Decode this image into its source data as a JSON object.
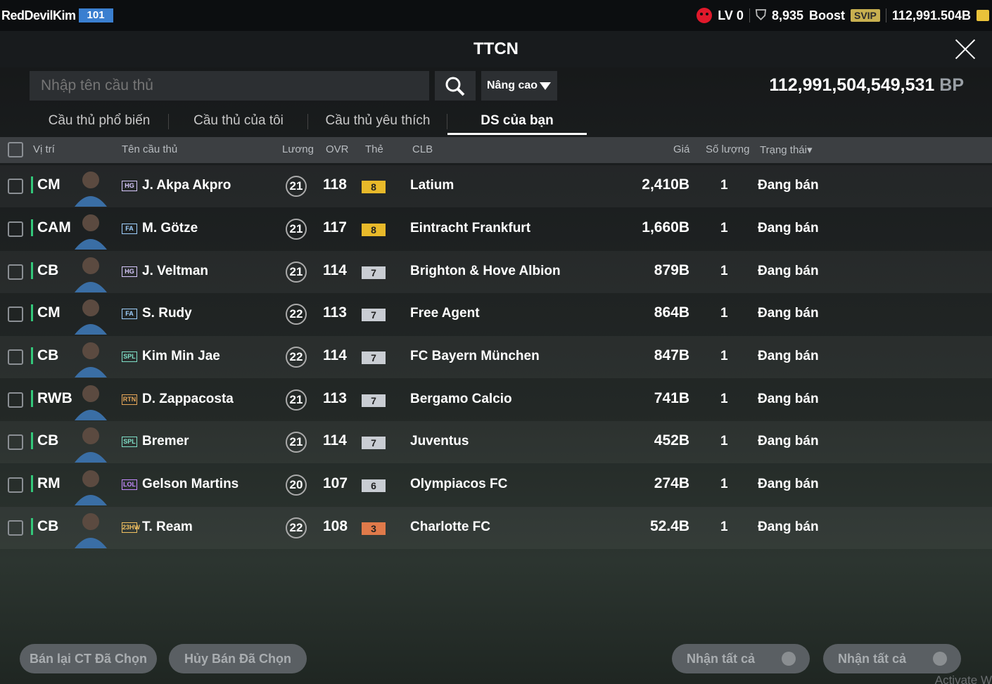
{
  "topbar": {
    "username": "RedDevilKim",
    "level_badge": "101",
    "lv": "LV 0",
    "shield_count": "8,935",
    "boost": "Boost",
    "svip": "SVIP",
    "coins": "112,991.504B"
  },
  "title": "TTCN",
  "search": {
    "placeholder": "Nhập tên cầu thủ",
    "advanced": "Nâng cao"
  },
  "bp": {
    "value": "112,991,504,549,531",
    "unit": "BP"
  },
  "tabs": [
    "Cầu thủ phổ biến",
    "Cầu thủ của tôi",
    "Cầu thủ yêu thích",
    "DS của bạn"
  ],
  "headers": {
    "position": "Vị trí",
    "name": "Tên cầu thủ",
    "wage": "Lương",
    "ovr": "OVR",
    "card": "Thẻ",
    "club": "CLB",
    "price": "Giá",
    "qty": "Số lượng",
    "status": "Trạng thái▾"
  },
  "rows": [
    {
      "pos": "CM",
      "season": "HG",
      "season_color": "#d8c9ff",
      "name": "J. Akpa Akpro",
      "wage": "21",
      "ovr": "118",
      "card": "8",
      "card_color": "#e8b92a",
      "club": "Latium",
      "price": "2,410B",
      "qty": "1",
      "status": "Đang bán"
    },
    {
      "pos": "CAM",
      "season": "FA",
      "season_color": "#9fd0ff",
      "name": "M. Götze",
      "wage": "21",
      "ovr": "117",
      "card": "8",
      "card_color": "#e8b92a",
      "club": "Eintracht Frankfurt",
      "price": "1,660B",
      "qty": "1",
      "status": "Đang bán"
    },
    {
      "pos": "CB",
      "season": "HG",
      "season_color": "#d8c9ff",
      "name": "J. Veltman",
      "wage": "21",
      "ovr": "114",
      "card": "7",
      "card_color": "#c9cdd3",
      "club": "Brighton & Hove Albion",
      "price": "879B",
      "qty": "1",
      "status": "Đang bán"
    },
    {
      "pos": "CM",
      "season": "FA",
      "season_color": "#9fd0ff",
      "name": "S. Rudy",
      "wage": "22",
      "ovr": "113",
      "card": "7",
      "card_color": "#c9cdd3",
      "club": "Free Agent",
      "price": "864B",
      "qty": "1",
      "status": "Đang bán"
    },
    {
      "pos": "CB",
      "season": "SPL",
      "season_color": "#7fe0c8",
      "name": "Kim Min Jae",
      "wage": "22",
      "ovr": "114",
      "card": "7",
      "card_color": "#c9cdd3",
      "club": "FC Bayern München",
      "price": "847B",
      "qty": "1",
      "status": "Đang bán"
    },
    {
      "pos": "RWB",
      "season": "RTN",
      "season_color": "#e6a75a",
      "name": "D. Zappacosta",
      "wage": "21",
      "ovr": "113",
      "card": "7",
      "card_color": "#c9cdd3",
      "club": "Bergamo Calcio",
      "price": "741B",
      "qty": "1",
      "status": "Đang bán"
    },
    {
      "pos": "CB",
      "season": "SPL",
      "season_color": "#7fe0c8",
      "name": "Bremer",
      "wage": "21",
      "ovr": "114",
      "card": "7",
      "card_color": "#c9cdd3",
      "club": "Juventus",
      "price": "452B",
      "qty": "1",
      "status": "Đang bán"
    },
    {
      "pos": "RM",
      "season": "LOL",
      "season_color": "#c58bff",
      "name": "Gelson Martins",
      "wage": "20",
      "ovr": "107",
      "card": "6",
      "card_color": "#c9cdd3",
      "club": "Olympiacos FC",
      "price": "274B",
      "qty": "1",
      "status": "Đang bán"
    },
    {
      "pos": "CB",
      "season": "23HW",
      "season_color": "#f0c060",
      "name": "T. Ream",
      "wage": "22",
      "ovr": "108",
      "card": "3",
      "card_color": "#e07a4a",
      "club": "Charlotte FC",
      "price": "52.4B",
      "qty": "1",
      "status": "Đang bán"
    }
  ],
  "buttons": {
    "resell": "Bán lại CT Đã Chọn",
    "cancel": "Hủy Bán Đã Chọn",
    "claim1": "Nhận tất cả",
    "claim2": "Nhận tất cả"
  },
  "watermark": "Activate W"
}
